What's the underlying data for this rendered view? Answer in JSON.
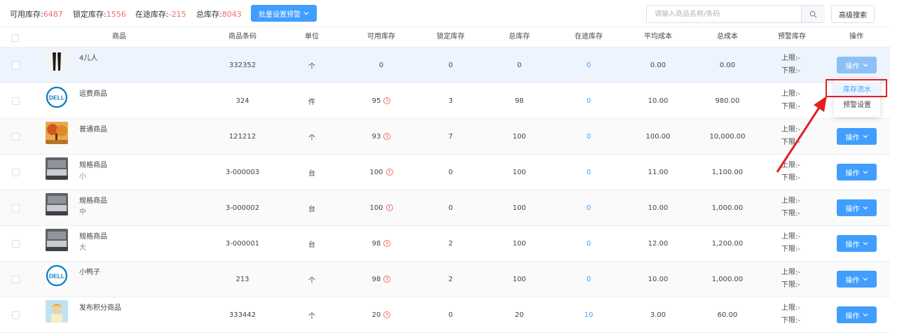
{
  "stats": [
    {
      "label": "可用库存:",
      "value": "6487"
    },
    {
      "label": "锁定库存:",
      "value": "1556"
    },
    {
      "label": "在途库存:",
      "value": "-215"
    },
    {
      "label": "总库存:",
      "value": "8043"
    }
  ],
  "toolbar": {
    "batch_label": "批量设置预警",
    "search_placeholder": "请输入商品名称/条码",
    "advanced_label": "高级搜索"
  },
  "columns": [
    "商品",
    "商品条码",
    "单位",
    "可用库存",
    "锁定库存",
    "总库存",
    "在途库存",
    "平均成本",
    "总成本",
    "预警库存",
    "操作"
  ],
  "alert_labels": {
    "upper": "上限:",
    "lower": "下限:",
    "value": "-"
  },
  "op_label": "操作",
  "dropdown": {
    "items": [
      "库存流水",
      "预警设置"
    ]
  },
  "rows": [
    {
      "name": "4儿人",
      "spec": "",
      "barcode": "332352",
      "unit": "个",
      "available": "0",
      "warn": false,
      "locked": "0",
      "total": "0",
      "transit": "0",
      "avg_cost": "0.00",
      "total_cost": "0.00",
      "thumb": "pants"
    },
    {
      "name": "运费商品",
      "spec": "",
      "barcode": "324",
      "unit": "件",
      "available": "95",
      "warn": true,
      "locked": "3",
      "total": "98",
      "transit": "0",
      "avg_cost": "10.00",
      "total_cost": "980.00",
      "thumb": "dell"
    },
    {
      "name": "普通商品",
      "spec": "",
      "barcode": "121212",
      "unit": "个",
      "available": "93",
      "warn": true,
      "locked": "7",
      "total": "100",
      "transit": "0",
      "avg_cost": "100.00",
      "total_cost": "10,000.00",
      "thumb": "tree"
    },
    {
      "name": "规格商品",
      "spec": "小",
      "barcode": "3-000003",
      "unit": "台",
      "available": "100",
      "warn": true,
      "locked": "0",
      "total": "100",
      "transit": "0",
      "avg_cost": "11.00",
      "total_cost": "1,100.00",
      "thumb": "room"
    },
    {
      "name": "规格商品",
      "spec": "中",
      "barcode": "3-000002",
      "unit": "台",
      "available": "100",
      "warn": true,
      "locked": "0",
      "total": "100",
      "transit": "0",
      "avg_cost": "10.00",
      "total_cost": "1,000.00",
      "thumb": "room"
    },
    {
      "name": "规格商品",
      "spec": "大",
      "barcode": "3-000001",
      "unit": "台",
      "available": "98",
      "warn": true,
      "locked": "2",
      "total": "100",
      "transit": "0",
      "avg_cost": "12.00",
      "total_cost": "1,200.00",
      "thumb": "room"
    },
    {
      "name": "小鸭子",
      "spec": "",
      "barcode": "213",
      "unit": "个",
      "available": "98",
      "warn": true,
      "locked": "2",
      "total": "100",
      "transit": "0",
      "avg_cost": "10.00",
      "total_cost": "1,000.00",
      "thumb": "dell"
    },
    {
      "name": "发布积分商品",
      "spec": "",
      "barcode": "333442",
      "unit": "个",
      "available": "20",
      "warn": true,
      "locked": "0",
      "total": "20",
      "transit": "10",
      "avg_cost": "3.00",
      "total_cost": "60.00",
      "thumb": "kid"
    }
  ],
  "colors": {
    "accent": "#409eff",
    "danger": "#f56c6c",
    "annotation": "#e02020"
  }
}
